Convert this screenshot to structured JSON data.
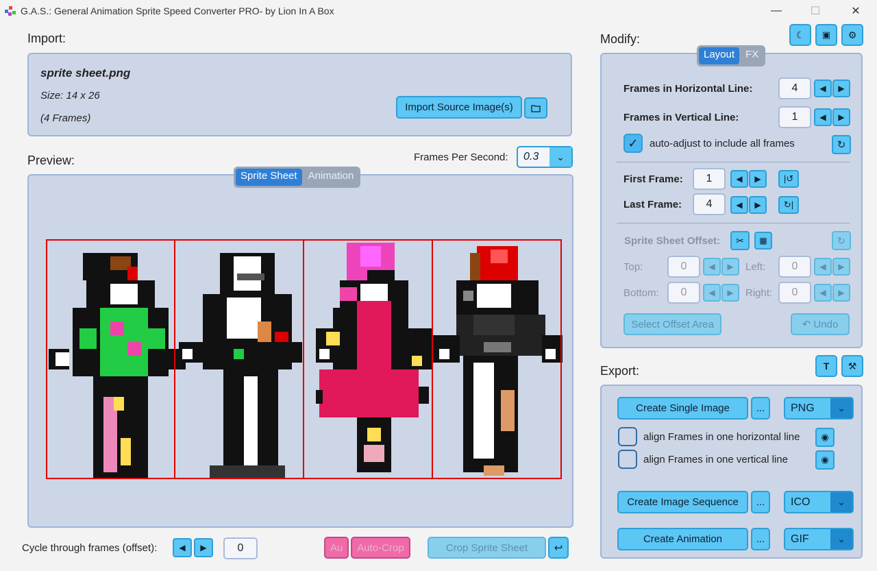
{
  "window": {
    "title": "G.A.S.: General Animation Sprite Speed Converter PRO- by Lion In A Box",
    "minimize": "—",
    "maximize": "☐",
    "close": "✕"
  },
  "import": {
    "label": "Import:",
    "file_name": "sprite sheet.png",
    "size": "Size: 14 x 26",
    "frames": "(4 Frames)",
    "import_button": "Import Source Image(s)",
    "folder_icon": "folder-icon"
  },
  "preview": {
    "label": "Preview:",
    "fps_label": "Frames Per Second:",
    "fps_value": "0.3",
    "tabs": [
      "Sprite Sheet",
      "Animation"
    ],
    "active_tab": "Sprite Sheet",
    "cycle_label": "Cycle through frames (offset):",
    "cycle_value": "0",
    "au_button": "Au",
    "autocrop_button": "Auto-Crop",
    "crop_button": "Crop Sprite Sheet",
    "return_icon": "return-icon",
    "frame_border_color": "#e00000"
  },
  "modify": {
    "label": "Modify:",
    "tabs": [
      "Layout",
      "FX"
    ],
    "active_tab": "Layout",
    "horiz_label": "Frames in Horizontal Line:",
    "horiz_value": "4",
    "vert_label": "Frames in Vertical Line:",
    "vert_value": "1",
    "auto_adjust_label": "auto-adjust to include all frames",
    "first_label": "First Frame:",
    "first_value": "1",
    "last_label": "Last Frame:",
    "last_value": "4",
    "offset_label": "Sprite Sheet Offset:",
    "top_label": "Top:",
    "top_value": "0",
    "left_label": "Left:",
    "left_value": "0",
    "bottom_label": "Bottom:",
    "bottom_value": "0",
    "right_label": "Right:",
    "right_value": "0",
    "select_offset_button": "Select Offset Area",
    "undo_button": "↶ Undo"
  },
  "export": {
    "label": "Export:",
    "single_button": "Create Single Image",
    "single_format": "PNG",
    "align_h_label": "align Frames in one horizontal line",
    "align_v_label": "align Frames in one vertical line",
    "sequence_button": "Create Image Sequence",
    "sequence_format": "ICO",
    "animation_button": "Create Animation",
    "animation_format": "GIF",
    "more": "..."
  },
  "colors": {
    "accent": "#5cc6f5",
    "panel": "#cdd6e6",
    "tab_active": "#2f7fd6"
  }
}
